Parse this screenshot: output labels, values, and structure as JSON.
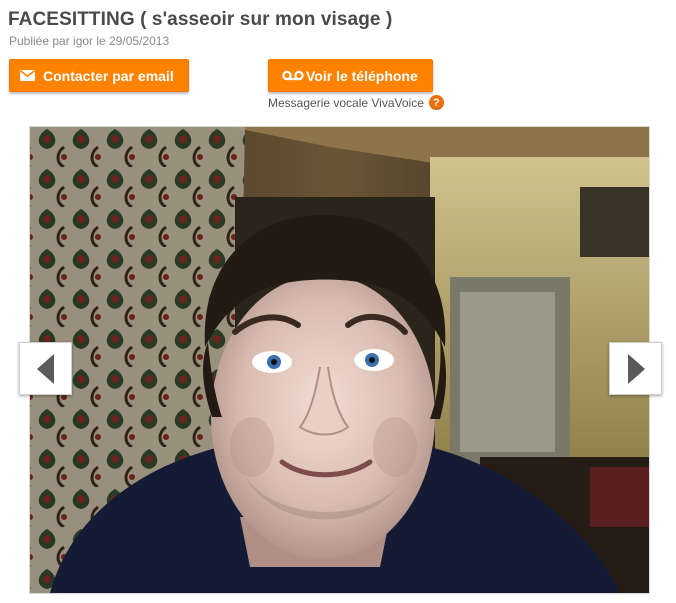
{
  "listing": {
    "title": "FACESITTING ( s'asseoir sur mon visage )",
    "published": "Publiée par igor le 29/05/2013"
  },
  "actions": {
    "email_label": "Contacter par email",
    "email_icon": "envelope-icon",
    "phone_label": "Voir le téléphone",
    "phone_icon": "voicemail-icon",
    "voicemail_note": "Messagerie vocale VivaVoice",
    "help_icon": "question-mark-icon",
    "help_glyph": "?"
  },
  "gallery": {
    "photo": "webcam-selfie-photo",
    "prev_icon": "arrow-left-icon",
    "next_icon": "arrow-right-icon"
  },
  "colors": {
    "accent": "#ff8200",
    "title_text": "#4a4a4a",
    "muted_text": "#8a8a8a"
  }
}
